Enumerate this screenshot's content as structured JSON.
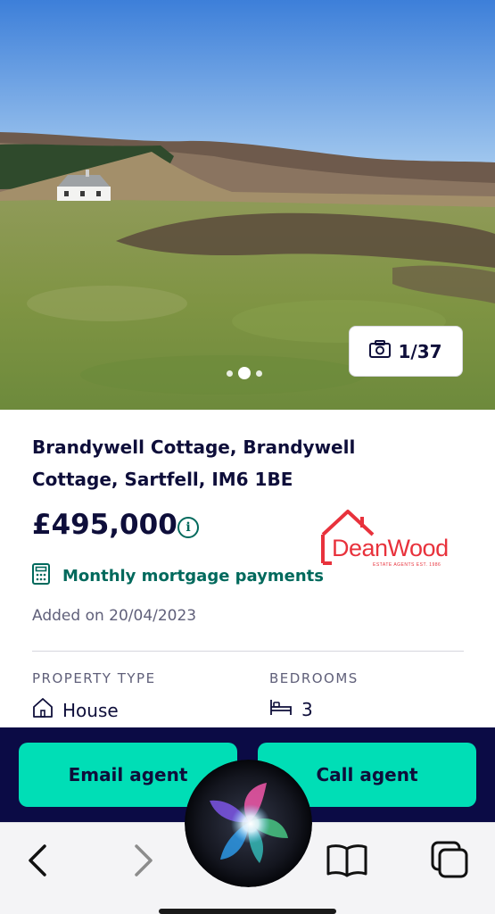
{
  "listing": {
    "address": "Brandywell Cottage, Brandywell Cottage, Sartfell, IM6 1BE",
    "price": "£495,000",
    "price_info_icon": "info-icon",
    "mortgage_label": "Monthly mortgage payments",
    "mortgage_icon": "calculator-icon",
    "added": "Added on 20/04/2023"
  },
  "gallery": {
    "counter": "1/37",
    "camera_icon": "camera-icon"
  },
  "agent": {
    "logo_text": "DeanWood",
    "logo_tagline": "ESTATE AGENTS EST. 1986",
    "brand_color": "#e8323c"
  },
  "key_facts": {
    "property_type_label": "PROPERTY TYPE",
    "property_type_value": "House",
    "property_type_icon": "house-icon",
    "bedrooms_label": "BEDROOMS",
    "bedrooms_value": "3",
    "bedrooms_icon": "bed-icon"
  },
  "actions": {
    "email_label": "Email agent",
    "call_label": "Call agent",
    "button_color": "#00deb6",
    "bar_color": "#0b0b45"
  },
  "browser_toolbar": {
    "back_icon": "chevron-left-icon",
    "forward_icon": "chevron-right-icon",
    "bookmarks_icon": "book-icon",
    "tabs_icon": "tabs-icon"
  }
}
